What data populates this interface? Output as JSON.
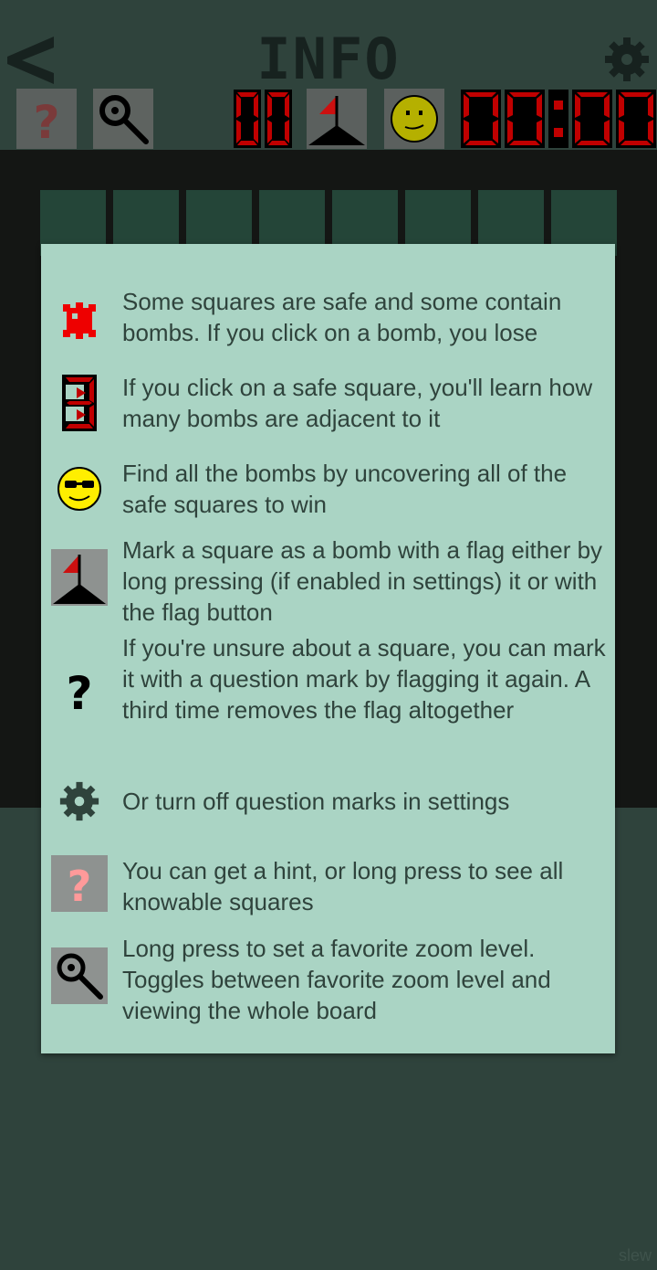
{
  "header": {
    "title": "INFO",
    "back_icon": "back-chevron-icon",
    "settings_icon": "gear-icon",
    "mine_counter": "00",
    "timer": "00:00"
  },
  "colors": {
    "background": "#2f433c",
    "board": "#141614",
    "cell": "#244538",
    "dialog": "#aad4c4",
    "text": "#2f433c",
    "seven_segment": "#c00000"
  },
  "dialog": {
    "items": [
      {
        "icon": "bomb-icon",
        "text": "Some squares are safe and some contain bombs. If you click on a bomb, you lose"
      },
      {
        "icon": "number-three-icon",
        "text": "If you click on a safe square, you'll learn how many bombs are adjacent to it"
      },
      {
        "icon": "sunglasses-face-icon",
        "text": "Find all the bombs by uncovering all of the safe squares to win"
      },
      {
        "icon": "flag-icon",
        "text": "Mark a square as a bomb with a flag either by long pressing (if enabled in settings) it or with the flag button"
      },
      {
        "icon": "question-mark-icon",
        "text": "If you're unsure about a square, you can mark it with a question mark by flagging it again. A third time removes the flag altogether"
      },
      {
        "icon": "gear-icon",
        "text": "Or turn off question marks in settings"
      },
      {
        "icon": "hint-icon",
        "text": "You can get a hint, or long press to see all knowable squares"
      },
      {
        "icon": "magnifier-icon",
        "text": "Long press to set a favorite zoom level. Toggles between favorite zoom level and viewing the whole board"
      }
    ]
  },
  "watermark": "slew"
}
